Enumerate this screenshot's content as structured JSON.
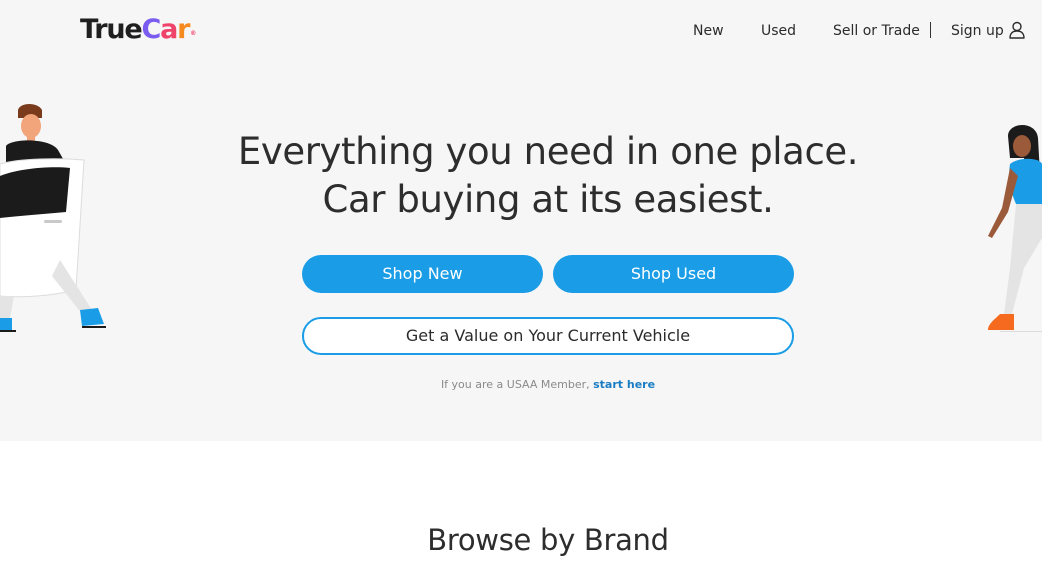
{
  "header": {
    "logo": {
      "part1": "True",
      "part2a": "C",
      "part2b": "a",
      "part2c": "r",
      "registered": "®"
    },
    "nav": {
      "new": "New",
      "used": "Used",
      "sell_or_trade": "Sell or Trade",
      "sign_up": "Sign up"
    },
    "user_icon": "user-icon"
  },
  "hero": {
    "headline_line1": "Everything you need in one place.",
    "headline_line2": "Car buying at its easiest.",
    "shop_new": "Shop New",
    "shop_used": "Shop Used",
    "get_value": "Get a Value on Your Current Vehicle",
    "usaa_text": "If you are a USAA Member,",
    "usaa_link": "start here"
  },
  "browse": {
    "title": "Browse by Brand"
  },
  "colors": {
    "accent": "#1a9de6",
    "hero_bg": "#f6f6f6",
    "link": "#1a7dc4"
  }
}
